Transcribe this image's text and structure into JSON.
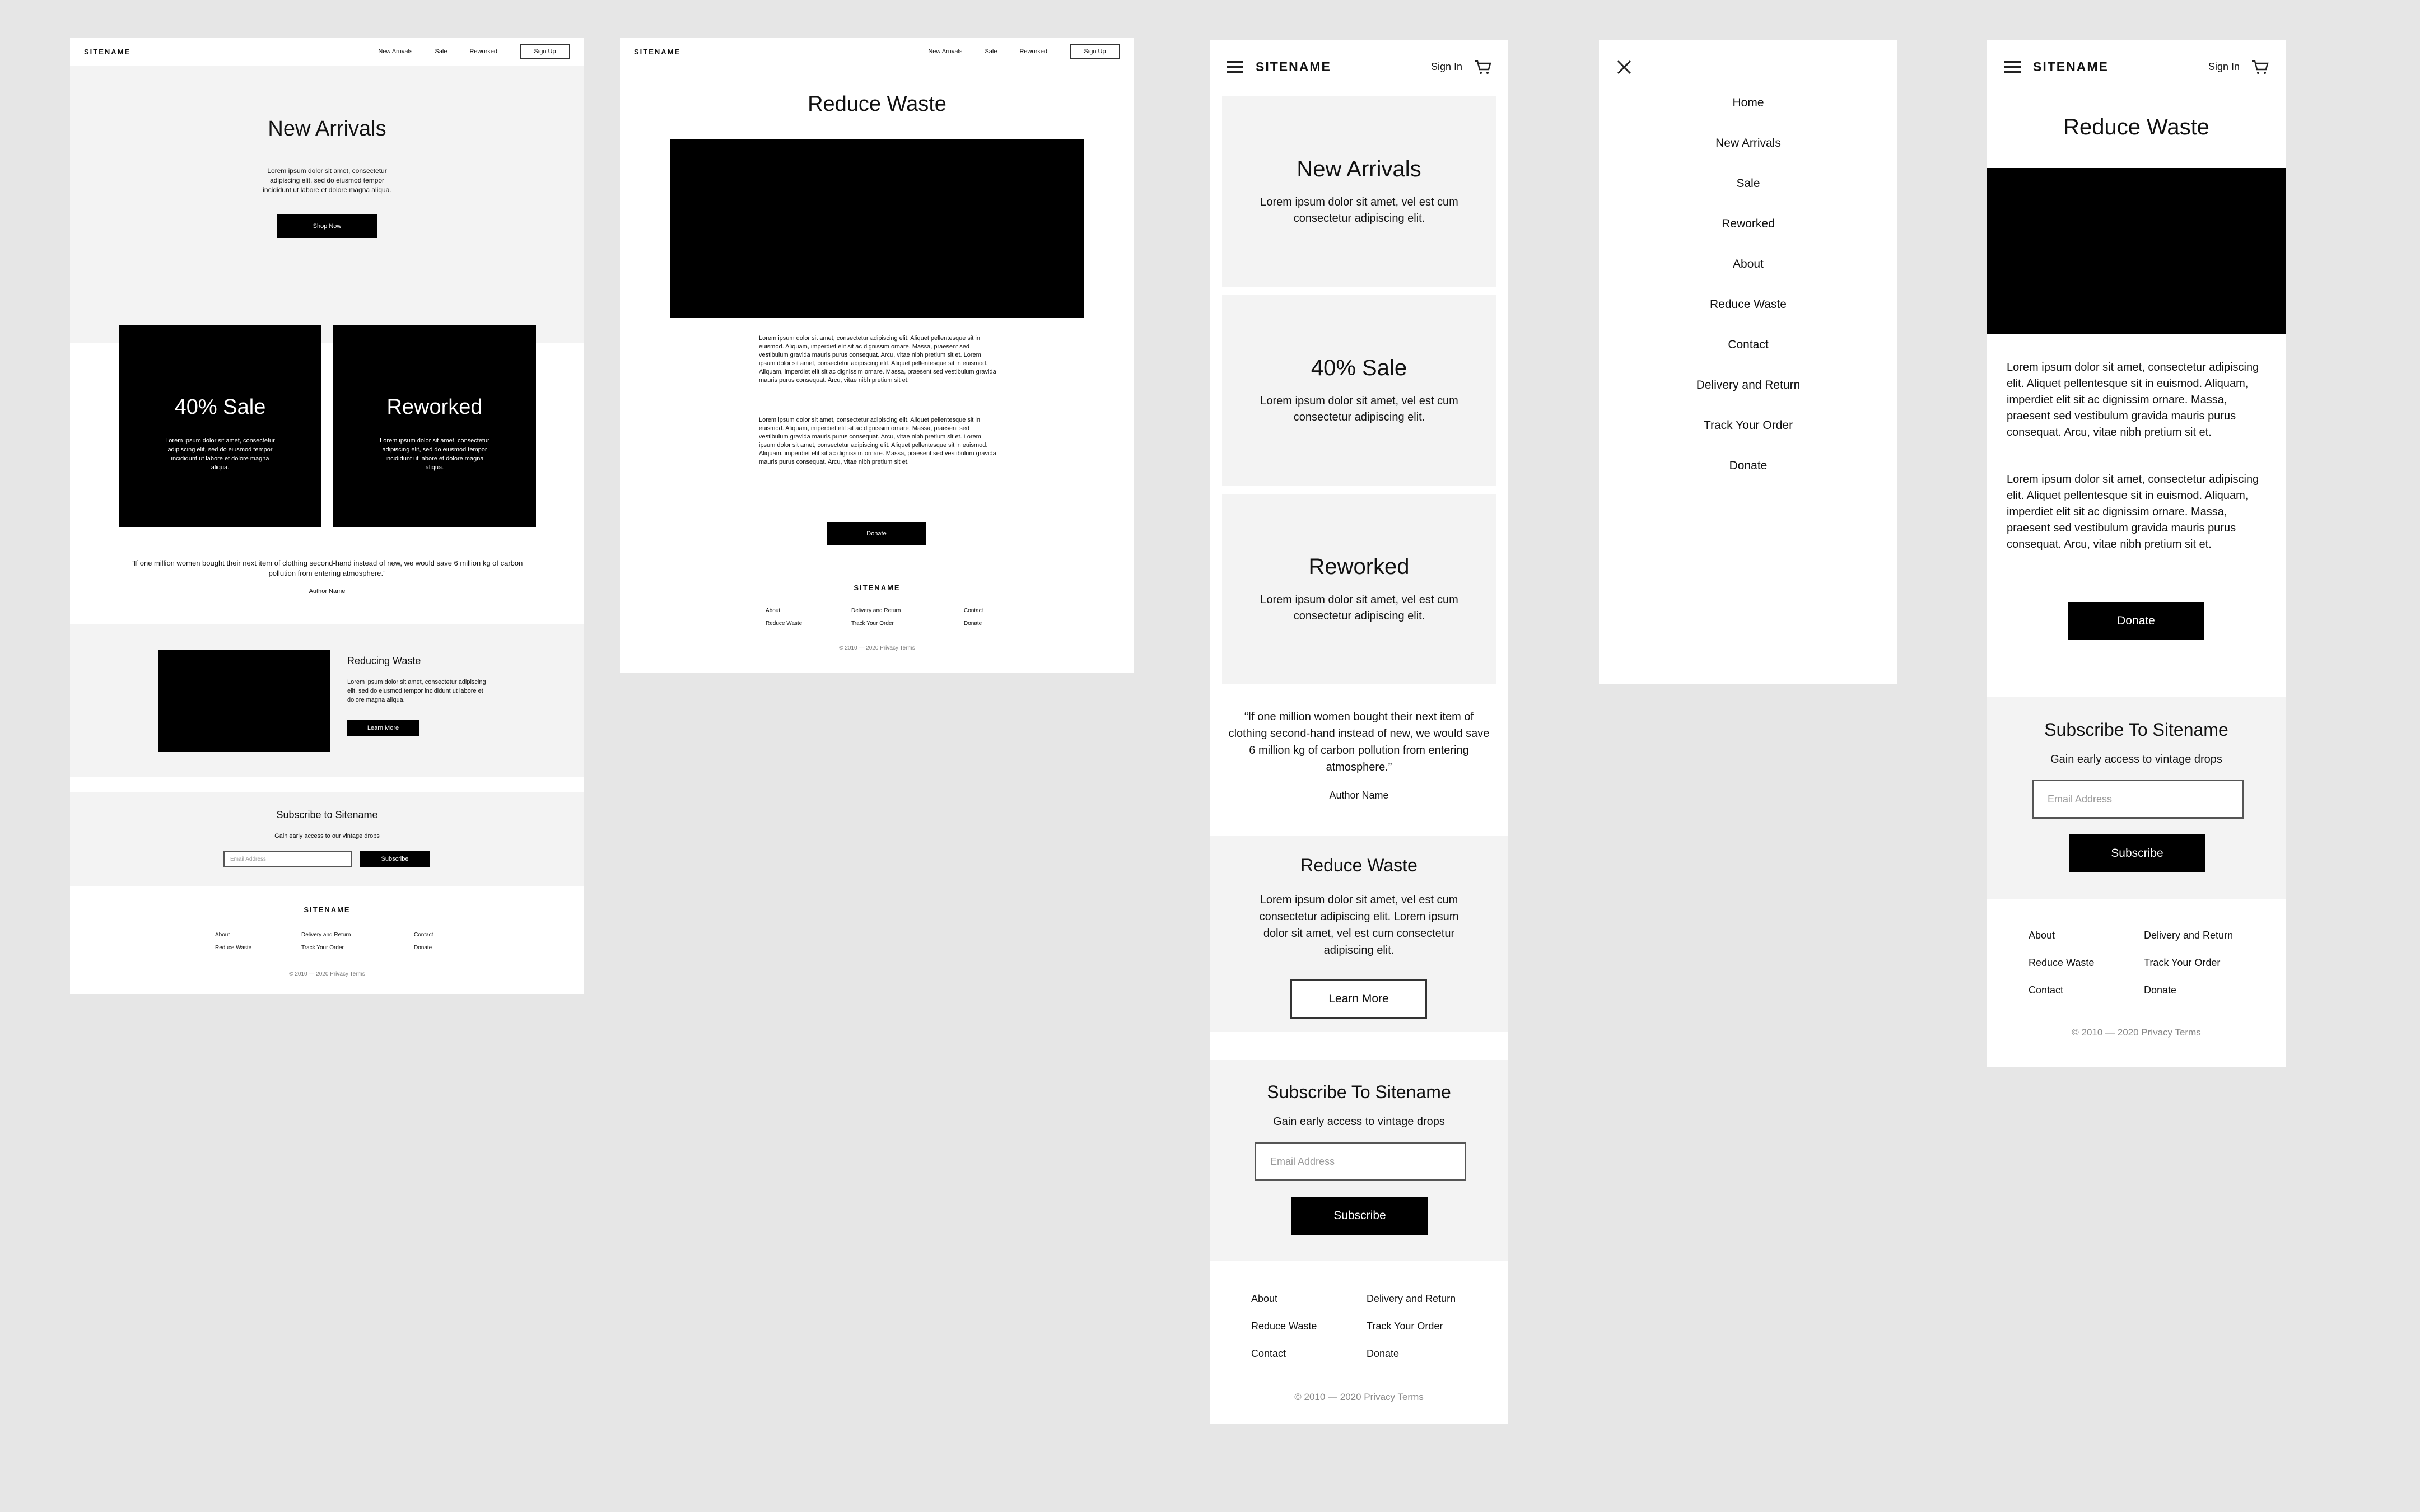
{
  "site": {
    "brand": "SITENAME",
    "nav": [
      "New Arrivals",
      "Sale",
      "Reworked"
    ],
    "signup": "Sign Up",
    "signin": "Sign In"
  },
  "home": {
    "hero_title": "New Arrivals",
    "hero_text": "Lorem ipsum dolor sit amet, consectetur adipiscing elit, sed do eiusmod tempor incididunt ut labore et dolore magna aliqua.",
    "hero_button": "Shop Now",
    "cards": [
      {
        "title": "40% Sale",
        "text": "Lorem ipsum dolor sit amet, consectetur adipiscing elit, sed do eiusmod tempor incididunt ut labore et dolore magna aliqua."
      },
      {
        "title": "Reworked",
        "text": "Lorem ipsum dolor sit amet, consectetur adipiscing elit, sed do eiusmod tempor incididunt ut labore et dolore magna aliqua."
      }
    ],
    "quote": "“If one million women bought their next item of clothing second-hand instead of new, we would save 6 million kg of carbon pollution from entering atmosphere.”",
    "author": "Author Name",
    "feature_title": "Reducing Waste",
    "feature_text": "Lorem ipsum dolor sit amet, consectetur adipiscing elit, sed do eiusmod tempor incididunt ut labore et dolore magna aliqua.",
    "feature_button": "Learn More",
    "subscribe_title": "Subscribe to Sitename",
    "subscribe_text": "Gain early access to our vintage drops",
    "email_placeholder": "Email Address",
    "subscribe_button": "Subscribe"
  },
  "footer": {
    "brand": "SITENAME",
    "col1": [
      "About",
      "Reduce Waste"
    ],
    "col2": [
      "Delivery and Return",
      "Track Your Order"
    ],
    "col3": [
      "Contact",
      "Donate"
    ],
    "copyright": "© 2010 — 2020 Privacy Terms"
  },
  "waste": {
    "title": "Reduce Waste",
    "p1": "Lorem ipsum dolor sit amet, consectetur adipiscing elit. Aliquet pellentesque sit in euismod. Aliquam, imperdiet elit sit ac dignissim ornare. Massa, praesent sed vestibulum gravida mauris purus consequat. Arcu, vitae nibh pretium sit et. Lorem ipsum dolor sit amet, consectetur adipiscing elit. Aliquet pellentesque sit in euismod. Aliquam, imperdiet elit sit ac dignissim ornare. Massa, praesent sed vestibulum gravida mauris purus consequat. Arcu, vitae nibh pretium sit et.",
    "p2": "Lorem ipsum dolor sit amet, consectetur adipiscing elit. Aliquet pellentesque sit in euismod. Aliquam, imperdiet elit sit ac dignissim ornare. Massa, praesent sed vestibulum gravida mauris purus consequat. Arcu, vitae nibh pretium sit et. Lorem ipsum dolor sit amet, consectetur adipiscing elit. Aliquet pellentesque sit in euismod. Aliquam, imperdiet elit sit ac dignissim ornare. Massa, praesent sed vestibulum gravida mauris purus consequat. Arcu, vitae nibh pretium sit et.",
    "button": "Donate"
  },
  "mobile": {
    "cards": [
      {
        "title": "New Arrivals",
        "text": "Lorem ipsum dolor sit amet, vel est cum consectetur adipiscing elit."
      },
      {
        "title": "40% Sale",
        "text": "Lorem ipsum dolor sit amet, vel est cum consectetur adipiscing elit."
      },
      {
        "title": "Reworked",
        "text": "Lorem ipsum dolor sit amet, vel est cum consectetur adipiscing elit."
      }
    ],
    "quote": "“If one million women bought their next item of clothing second-hand instead of new, we would save 6 million kg of carbon pollution from entering atmosphere.”",
    "author": "Author Name",
    "waste_title": "Reduce Waste",
    "waste_text": "Lorem ipsum dolor sit amet, vel est cum consectetur adipiscing elit. Lorem ipsum dolor sit amet, vel est cum consectetur adipiscing elit.",
    "waste_button": "Learn More",
    "subscribe_title": "Subscribe To Sitename",
    "subscribe_text": "Gain early access to vintage drops",
    "email_placeholder": "Email Address",
    "subscribe_button": "Subscribe"
  },
  "menu": {
    "items": [
      "Home",
      "New Arrivals",
      "Sale",
      "Reworked",
      "About",
      "Reduce Waste",
      "Contact",
      "Delivery and Return",
      "Track Your Order",
      "Donate"
    ]
  },
  "mobile_waste": {
    "title": "Reduce Waste",
    "p1": "Lorem ipsum dolor sit amet, consectetur adipiscing elit. Aliquet pellentesque sit in euismod. Aliquam, imperdiet elit sit ac dignissim ornare. Massa, praesent sed vestibulum gravida mauris purus consequat. Arcu, vitae nibh pretium sit et.",
    "p2": "Lorem ipsum dolor sit amet, consectetur adipiscing elit. Aliquet pellentesque sit in euismod. Aliquam, imperdiet elit sit ac dignissim ornare. Massa, praesent sed vestibulum gravida mauris purus consequat. Arcu, vitae nibh pretium sit et.",
    "button": "Donate"
  }
}
